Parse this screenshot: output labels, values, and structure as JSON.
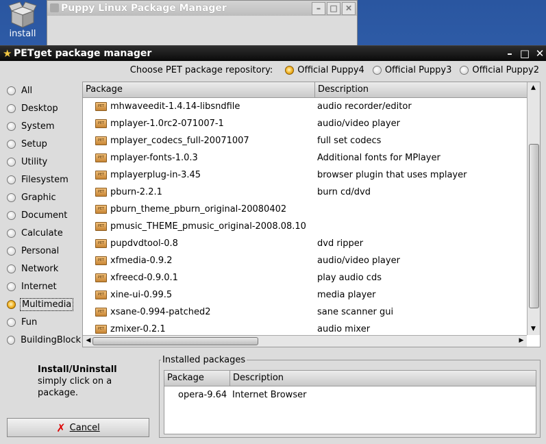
{
  "desktop": {
    "install_label": "install"
  },
  "bg_window": {
    "title": "Puppy Linux Package Manager"
  },
  "window": {
    "title": "PETget package manager"
  },
  "repo": {
    "label": "Choose PET package repository:",
    "options": [
      {
        "label": "Official Puppy4",
        "selected": true
      },
      {
        "label": "Official Puppy3",
        "selected": false
      },
      {
        "label": "Official Puppy2",
        "selected": false
      }
    ]
  },
  "categories": [
    {
      "label": "All",
      "selected": false
    },
    {
      "label": "Desktop",
      "selected": false
    },
    {
      "label": "System",
      "selected": false
    },
    {
      "label": "Setup",
      "selected": false
    },
    {
      "label": "Utility",
      "selected": false
    },
    {
      "label": "Filesystem",
      "selected": false
    },
    {
      "label": "Graphic",
      "selected": false
    },
    {
      "label": "Document",
      "selected": false
    },
    {
      "label": "Calculate",
      "selected": false
    },
    {
      "label": "Personal",
      "selected": false
    },
    {
      "label": "Network",
      "selected": false
    },
    {
      "label": "Internet",
      "selected": false
    },
    {
      "label": "Multimedia",
      "selected": true
    },
    {
      "label": "Fun",
      "selected": false
    },
    {
      "label": "BuildingBlock",
      "selected": false
    }
  ],
  "packages": {
    "columns": [
      "Package",
      "Description"
    ],
    "rows": [
      {
        "name": "mhwaveedit-1.4.14-libsndfile",
        "desc": "audio recorder/editor"
      },
      {
        "name": "mplayer-1.0rc2-071007-1",
        "desc": "audio/video player"
      },
      {
        "name": "mplayer_codecs_full-20071007",
        "desc": "full set codecs"
      },
      {
        "name": "mplayer-fonts-1.0.3",
        "desc": "Additional fonts for MPlayer"
      },
      {
        "name": "mplayerplug-in-3.45",
        "desc": "browser plugin that uses mplayer"
      },
      {
        "name": "pburn-2.2.1",
        "desc": "burn cd/dvd"
      },
      {
        "name": "pburn_theme_pburn_original-20080402",
        "desc": ""
      },
      {
        "name": "pmusic_THEME_pmusic_original-2008.08.10",
        "desc": ""
      },
      {
        "name": "pupdvdtool-0.8",
        "desc": "dvd ripper"
      },
      {
        "name": "xfmedia-0.9.2",
        "desc": "audio/video player"
      },
      {
        "name": "xfreecd-0.9.0.1",
        "desc": "play audio cds"
      },
      {
        "name": "xine-ui-0.99.5",
        "desc": "media player"
      },
      {
        "name": "xsane-0.994-patched2",
        "desc": "sane scanner gui"
      },
      {
        "name": "zmixer-0.2.1",
        "desc": "audio mixer"
      }
    ],
    "pet_icon_text": "PET"
  },
  "help": {
    "title": "Install/Uninstall",
    "body": "simply click on a package."
  },
  "cancel": {
    "label": "Cancel"
  },
  "installed": {
    "legend": "Installed packages",
    "columns": [
      "Package",
      "Description"
    ],
    "rows": [
      {
        "name": "opera-9.64",
        "desc": "Internet Browser"
      }
    ]
  }
}
